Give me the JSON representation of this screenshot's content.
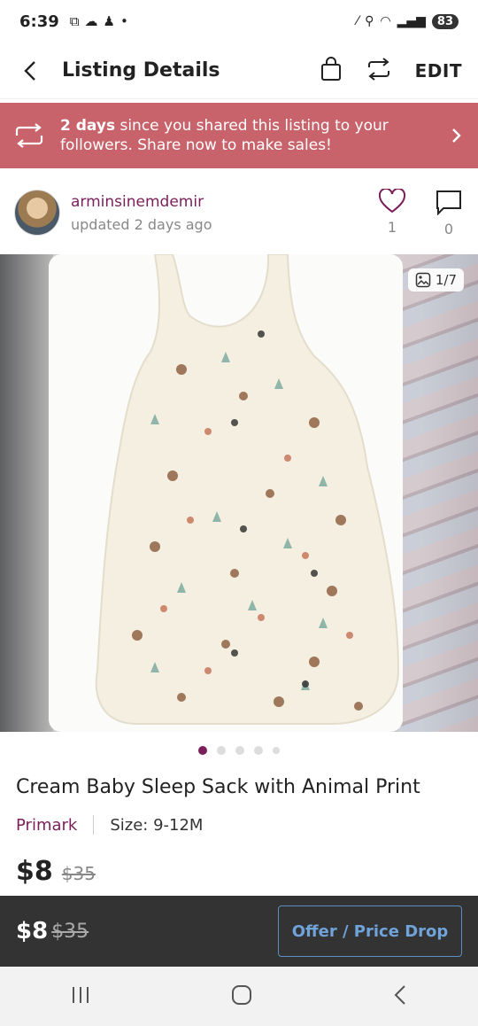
{
  "status_bar": {
    "time": "6:39",
    "battery": "83"
  },
  "header": {
    "title": "Listing Details",
    "edit_label": "EDIT"
  },
  "share_banner": {
    "bold": "2 days",
    "text": " since you shared this listing to your followers. Share now to make sales!"
  },
  "seller": {
    "username": "arminsinemdemir",
    "updated": "updated 2 days ago",
    "likes": "1",
    "comments": "0"
  },
  "gallery": {
    "counter": "1/7",
    "dots": 5,
    "active_index": 0
  },
  "listing": {
    "title": "Cream Baby Sleep Sack with Animal Print",
    "brand": "Primark",
    "size": "Size: 9-12M",
    "price": "$8",
    "original_price": "$35"
  },
  "bottom_bar": {
    "price": "$8",
    "original_price": "$35",
    "offer_label": "Offer / Price Drop"
  },
  "colors": {
    "banner": "#c9636b",
    "accent": "#7a1f5a",
    "offer_button": "#6fa3d9",
    "bottom_bar": "#333333"
  }
}
